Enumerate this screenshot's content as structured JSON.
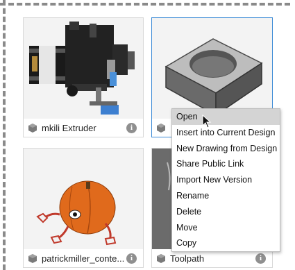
{
  "cards": [
    {
      "label": "mkili Extruder"
    },
    {
      "label": ""
    },
    {
      "label": "patrickmiller_conte..."
    },
    {
      "label": "Toolpath"
    }
  ],
  "info_glyph": "i",
  "context_menu": {
    "items": [
      "Open",
      "Insert into Current Design",
      "New Drawing from Design",
      "Share Public Link",
      "Import New Version",
      "Rename",
      "Delete",
      "Move",
      "Copy"
    ],
    "hovered": "Open"
  },
  "colors": {
    "selection_border": "#3b8ad6",
    "menu_hover": "#d4d4d4",
    "pumpkin": "#e06a1c"
  }
}
